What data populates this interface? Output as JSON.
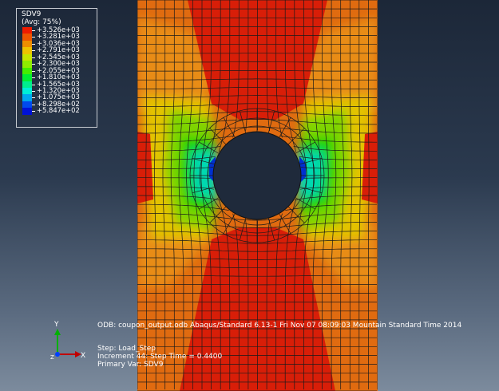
{
  "legend": {
    "title": "SDV9",
    "subtitle": "(Avg: 75%)",
    "entries": [
      {
        "label": "+3.526e+03",
        "color": "#ee1c00"
      },
      {
        "label": "+3.281e+03",
        "color": "#ee5500"
      },
      {
        "label": "+3.036e+03",
        "color": "#ee8e00"
      },
      {
        "label": "+2.791e+03",
        "color": "#eec400"
      },
      {
        "label": "+2.545e+03",
        "color": "#c6e600"
      },
      {
        "label": "+2.300e+03",
        "color": "#8fee00"
      },
      {
        "label": "+2.055e+03",
        "color": "#44ee00"
      },
      {
        "label": "+1.810e+03",
        "color": "#00ee33"
      },
      {
        "label": "+1.565e+03",
        "color": "#00ee8e"
      },
      {
        "label": "+1.320e+03",
        "color": "#00eed8"
      },
      {
        "label": "+1.075e+03",
        "color": "#00a8ee"
      },
      {
        "label": "+8.298e+02",
        "color": "#004aee"
      },
      {
        "label": "+5.847e+02",
        "color": "#0012d8"
      }
    ]
  },
  "info": {
    "odb_line": "ODB: coupon_output.odb    Abaqus/Standard 6.13-1    Fri Nov 07 08:09:03 Mountain Standard Time 2014",
    "step_line": "Step: Load_Step",
    "increment_line": "Increment     44: Step Time =    0.4400",
    "primary_var_line": "Primary Var: SDV9"
  },
  "triad": {
    "y_label": "Y",
    "x_label": "X",
    "z_label": "Z",
    "y_color": "#00b000",
    "x_color": "#c00000",
    "z_color": "#0040ff"
  }
}
